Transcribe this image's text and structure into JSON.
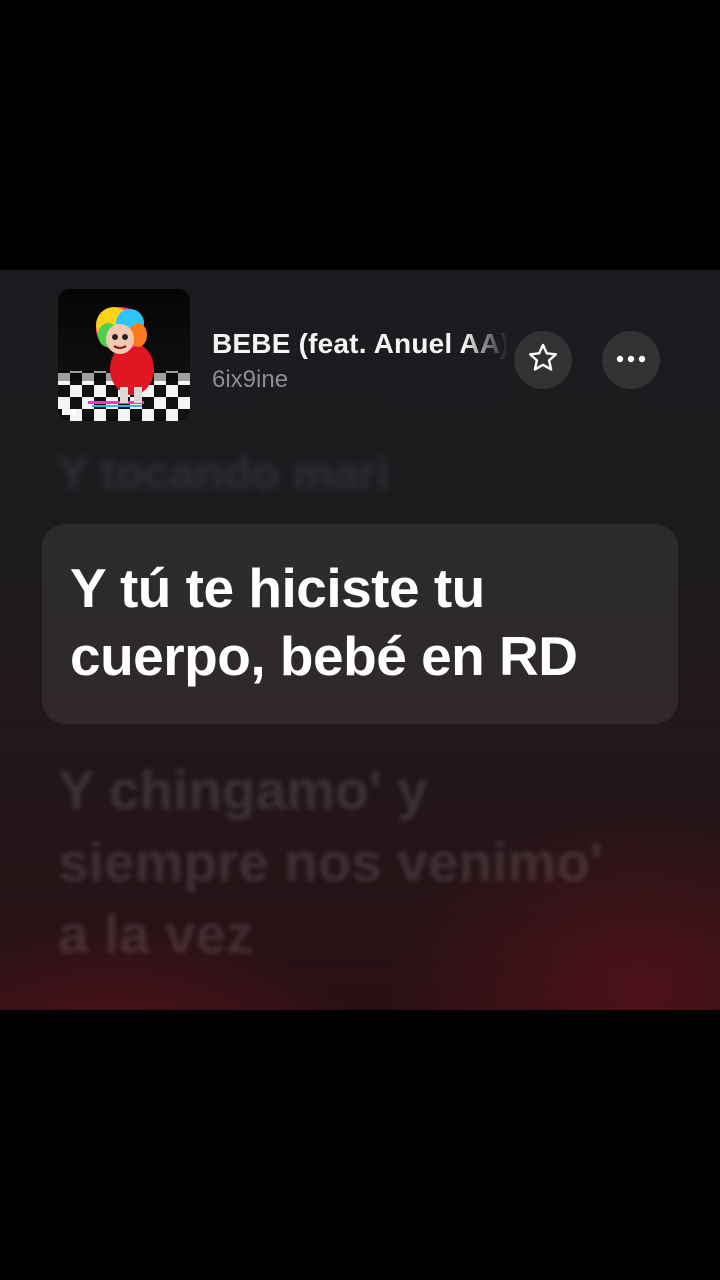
{
  "song": {
    "title": "BEBE (feat. Anuel AA)",
    "artist": "6ix9ine",
    "artwork_label": "TATTLE"
  },
  "controls": {
    "favorite_icon": "star-outline-icon",
    "more_icon": "ellipsis-icon"
  },
  "lyrics": {
    "previous": "Y tocando mari",
    "current": "Y tú te hiciste tu cuerpo, bebé en RD",
    "next_lines": [
      "Y chingamo' y",
      "siempre nos venimo'",
      "a la vez"
    ]
  },
  "colors": {
    "background": "#000000",
    "panel_top": "#1b1b1f",
    "panel_glow": "#961423",
    "active_lyric": "#ffffff",
    "artist_text": "#8d8d92"
  }
}
